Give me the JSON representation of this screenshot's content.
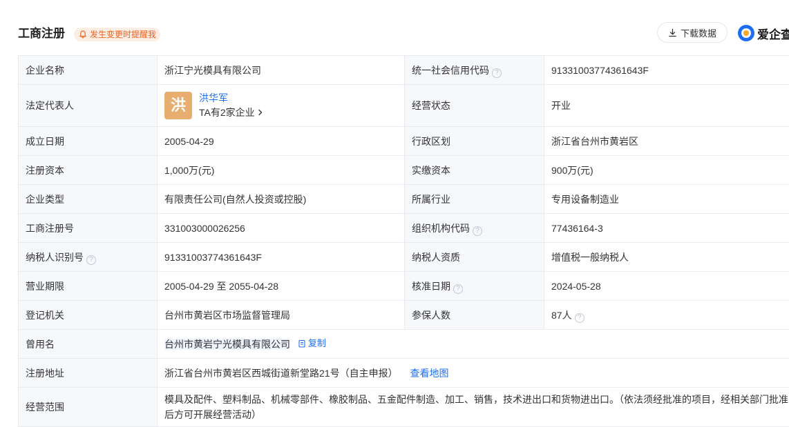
{
  "header": {
    "title": "工商注册",
    "remind_label": "发生变更时提醒我",
    "download_label": "下载数据",
    "brand_name": "爱企查"
  },
  "icons": {
    "remind": "bell-icon",
    "download": "download-icon",
    "help": "question-icon",
    "copy": "copy-icon",
    "more": "chevron-right-icon"
  },
  "colors": {
    "accent": "#1e6ef4",
    "remind": "#f0621f",
    "avatar": "#e7ae70",
    "label_bg": "#f6f8fb"
  },
  "rows": {
    "company_name_label": "企业名称",
    "company_name": "浙江宁光模具有限公司",
    "credit_code_label": "统一社会信用代码",
    "credit_code": "91331003774361643F",
    "legal_rep_label": "法定代表人",
    "legal_rep_avatar": "洪",
    "legal_rep_name": "洪华军",
    "legal_rep_companies": "TA有2家企业",
    "status_label": "经营状态",
    "status": "开业",
    "founded_label": "成立日期",
    "founded": "2005-04-29",
    "region_label": "行政区划",
    "region": "浙江省台州市黄岩区",
    "reg_capital_label": "注册资本",
    "reg_capital": "1,000万(元)",
    "paid_capital_label": "实缴资本",
    "paid_capital": "900万(元)",
    "company_type_label": "企业类型",
    "company_type": "有限责任公司(自然人投资或控股)",
    "industry_label": "所属行业",
    "industry": "专用设备制造业",
    "reg_no_label": "工商注册号",
    "reg_no": "331003000026256",
    "org_code_label": "组织机构代码",
    "org_code": "77436164-3",
    "taxpayer_id_label": "纳税人识别号",
    "taxpayer_id": "91331003774361643F",
    "taxpayer_qual_label": "纳税人资质",
    "taxpayer_qual": "增值税一般纳税人",
    "term_label": "营业期限",
    "term": "2005-04-29 至 2055-04-28",
    "approval_date_label": "核准日期",
    "approval_date": "2024-05-28",
    "authority_label": "登记机关",
    "authority": "台州市黄岩区市场监督管理局",
    "insured_label": "参保人数",
    "insured": "87人",
    "former_name_label": "曾用名",
    "former_name": "台州市黄岩宁光模具有限公司",
    "copy_label": "复制",
    "address_label": "注册地址",
    "address": "浙江省台州市黄岩区西城街道新堂路21号（自主申报）",
    "map_label": "查看地图",
    "scope_label": "经营范围",
    "scope": "模具及配件、塑料制品、机械零部件、橡胶制品、五金配件制造、加工、销售，技术进出口和货物进出口。（依法须经批准的项目，经相关部门批准后方可开展经营活动）"
  }
}
